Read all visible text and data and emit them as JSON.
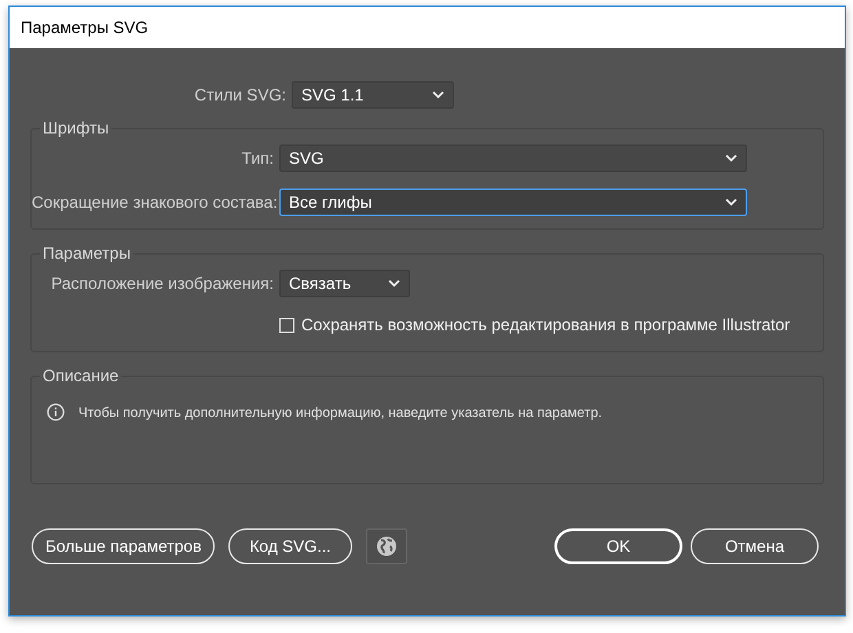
{
  "window": {
    "title": "Параметры SVG"
  },
  "svg_styles": {
    "label": "Стили SVG:",
    "value": "SVG 1.1"
  },
  "fonts": {
    "title": "Шрифты",
    "fields": [
      {
        "label": "Тип:",
        "value": "SVG",
        "focused": false
      },
      {
        "label": "Сокращение знакового состава:",
        "value": "Все глифы",
        "focused": true
      }
    ]
  },
  "options": {
    "title": "Параметры",
    "image_location": {
      "label": "Расположение изображения:",
      "value": "Связать"
    },
    "preserve_editing": {
      "label": "Сохранять возможность редактирования в программе Illustrator",
      "checked": false
    }
  },
  "description": {
    "title": "Описание",
    "text": "Чтобы получить дополнительную информацию, наведите указатель на параметр."
  },
  "buttons": [
    {
      "label": "Больше параметров",
      "kind": "pill"
    },
    {
      "label": "Код SVG...",
      "kind": "pill"
    },
    {
      "kind": "globe"
    },
    {
      "label": "OK",
      "kind": "primary"
    },
    {
      "label": "Отмена",
      "kind": "pill"
    }
  ]
}
